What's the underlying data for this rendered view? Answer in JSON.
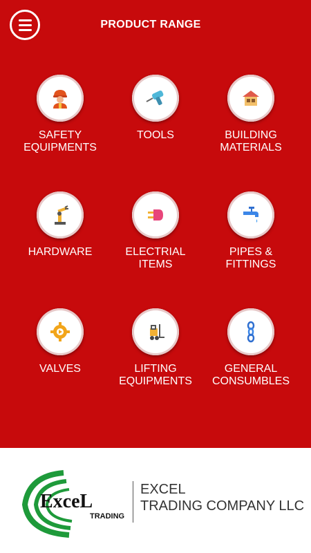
{
  "header": {
    "title": "PRODUCT RANGE"
  },
  "categories": [
    {
      "label": "SAFETY\nEQUIPMENTS",
      "icon": "safety-worker-icon"
    },
    {
      "label": "TOOLS",
      "icon": "drill-icon"
    },
    {
      "label": "BUILDING\nMATERIALS",
      "icon": "building-icon"
    },
    {
      "label": "HARDWARE",
      "icon": "robot-arm-icon"
    },
    {
      "label": "ELECTRIAL\nITEMS",
      "icon": "plug-icon"
    },
    {
      "label": "PIPES &\nFITTINGS",
      "icon": "faucet-icon"
    },
    {
      "label": "VALVES",
      "icon": "gear-valve-icon"
    },
    {
      "label": "LIFTING\nEQUIPMENTS",
      "icon": "forklift-icon"
    },
    {
      "label": "GENERAL\nCONSUMBLES",
      "icon": "chain-icon"
    }
  ],
  "footer": {
    "logo_word": "ExceL",
    "logo_sub": "TRADING",
    "company_line1": "EXCEL",
    "company_line2": "TRADING COMPANY LLC"
  },
  "colors": {
    "brand_red": "#c70a0c",
    "logo_green": "#1e9a3a"
  }
}
